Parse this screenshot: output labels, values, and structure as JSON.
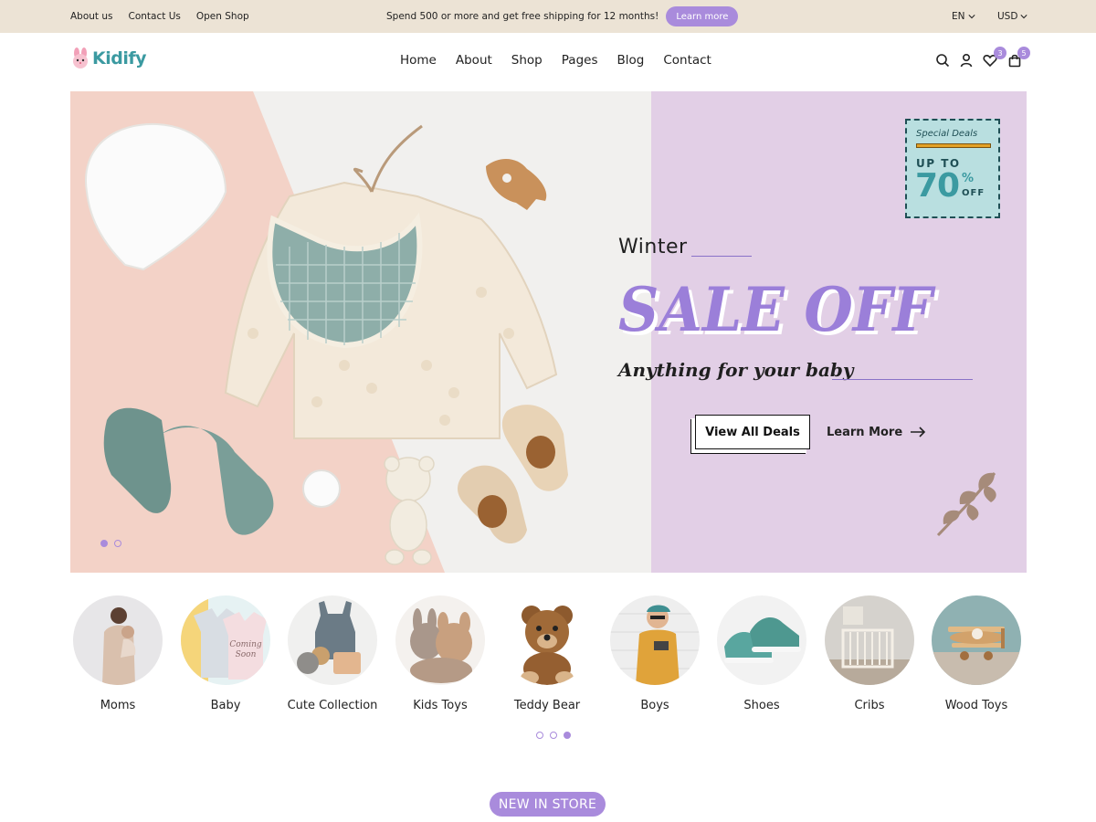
{
  "topbar": {
    "links": [
      "About us",
      "Contact Us",
      "Open Shop"
    ],
    "promo_text": "Spend 500 or more and get free shipping for 12 months!",
    "promo_button": "Learn more",
    "language": "EN",
    "currency": "USD"
  },
  "header": {
    "logo_text": "Kidify",
    "nav": [
      "Home",
      "About",
      "Shop",
      "Pages",
      "Blog",
      "Contact"
    ],
    "wishlist_count": "3",
    "cart_count": "5"
  },
  "hero": {
    "deal_label": "Special Deals",
    "deal_upto": "UP TO",
    "deal_value": "70",
    "deal_percent": "%",
    "deal_off": "OFF",
    "kicker": "Winter",
    "headline": "SALE OFF",
    "tagline": "Anything for your baby",
    "primary_button": "View All Deals",
    "secondary_button": "Learn More",
    "slides": 2,
    "active_slide": 0
  },
  "categories": {
    "items": [
      {
        "label": "Moms",
        "icon": "mother-photo"
      },
      {
        "label": "Baby",
        "icon": "baby-clothes-photo"
      },
      {
        "label": "Cute Collection",
        "icon": "toy-overalls-photo"
      },
      {
        "label": "Kids Toys",
        "icon": "plush-toys-photo"
      },
      {
        "label": "Teddy Bear",
        "icon": "teddy-bear-photo"
      },
      {
        "label": "Boys",
        "icon": "boy-photo"
      },
      {
        "label": "Shoes",
        "icon": "shoes-photo"
      },
      {
        "label": "Cribs",
        "icon": "crib-photo"
      },
      {
        "label": "Wood Toys",
        "icon": "wood-plane-photo"
      }
    ],
    "pages": 3,
    "active_page": 2
  },
  "section_pill": "NEW IN STORE",
  "colors": {
    "accent": "#a98bdc",
    "topbar_bg": "#ece3d5",
    "brand_teal": "#3b9aa1",
    "hero_left_bg": "#f3d2c7",
    "hero_right_bg": "#e2cfe6"
  }
}
